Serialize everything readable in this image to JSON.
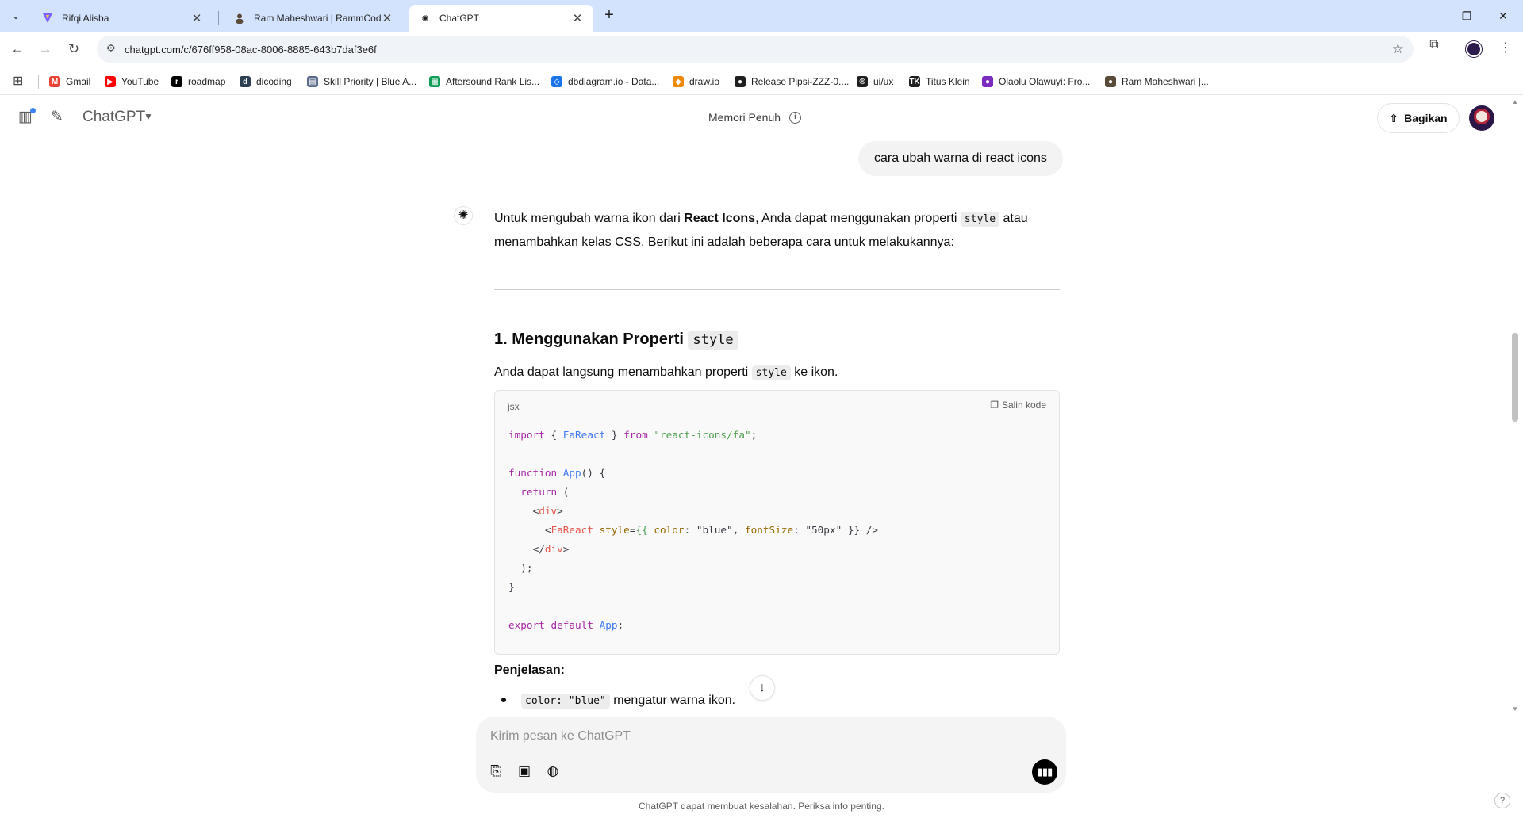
{
  "browser": {
    "tabs": [
      {
        "title": "Rifqi Alisba",
        "active": false
      },
      {
        "title": "Ram Maheshwari | RammCodes",
        "active": false
      },
      {
        "title": "ChatGPT",
        "active": true
      }
    ],
    "url": "chatgpt.com/c/676ff958-08ac-8006-8885-643b7daf3e6f",
    "bookmarks": [
      {
        "label": "Gmail",
        "icon": "gmail-icon",
        "color": "#ea4335"
      },
      {
        "label": "YouTube",
        "icon": "youtube-icon",
        "color": "#ff0000"
      },
      {
        "label": "roadmap",
        "icon": "roadmap-icon",
        "color": "#000000"
      },
      {
        "label": "dicoding",
        "icon": "dicoding-icon",
        "color": "#2d3e50"
      },
      {
        "label": "Skill Priority | Blue A...",
        "icon": "page-icon",
        "color": "#5b6b8c"
      },
      {
        "label": "Aftersound Rank Lis...",
        "icon": "sheets-icon",
        "color": "#0f9d58"
      },
      {
        "label": "dbdiagram.io - Data...",
        "icon": "dbdiagram-icon",
        "color": "#1a73e8"
      },
      {
        "label": "draw.io",
        "icon": "drawio-icon",
        "color": "#f08705"
      },
      {
        "label": "Release Pipsi-ZZZ-0....",
        "icon": "github-icon",
        "color": "#1f1f1f"
      },
      {
        "label": "ui/ux",
        "icon": "registered-icon",
        "color": "#1f1f1f"
      },
      {
        "label": "Titus Klein",
        "icon": "tk-icon",
        "color": "#1f1f1f"
      },
      {
        "label": "Olaolu Olawuyi: Fro...",
        "icon": "location-pin-icon",
        "color": "#7b2cbf"
      },
      {
        "label": "Ram Maheshwari |...",
        "icon": "person-icon",
        "color": "#5a4a3a"
      }
    ]
  },
  "header": {
    "model": "ChatGPT",
    "memory_label": "Memori Penuh",
    "share_label": "Bagikan"
  },
  "conversation": {
    "user_message": "cara ubah warna di react icons",
    "intro": {
      "pre": "Untuk mengubah warna ikon dari ",
      "bold": "React Icons",
      "mid": ", Anda dapat menggunakan properti ",
      "code": "style",
      "post1": " atau",
      "line2": "menambahkan kelas CSS. Berikut ini adalah beberapa cara untuk melakukannya:"
    },
    "section1": {
      "heading": "1. Menggunakan Properti ",
      "heading_code": "style",
      "desc_pre": "Anda dapat langsung menambahkan properti ",
      "desc_code": "style",
      "desc_post": " ke ikon."
    },
    "codeblock": {
      "language": "jsx",
      "copy_label": "Salin kode"
    },
    "explanation_label": "Penjelasan:",
    "bullets": [
      {
        "code": "color: \"blue\"",
        "text": " mengatur warna ikon."
      }
    ]
  },
  "composer": {
    "placeholder": "Kirim pesan ke ChatGPT",
    "disclaimer": "ChatGPT dapat membuat kesalahan. Periksa info penting."
  }
}
